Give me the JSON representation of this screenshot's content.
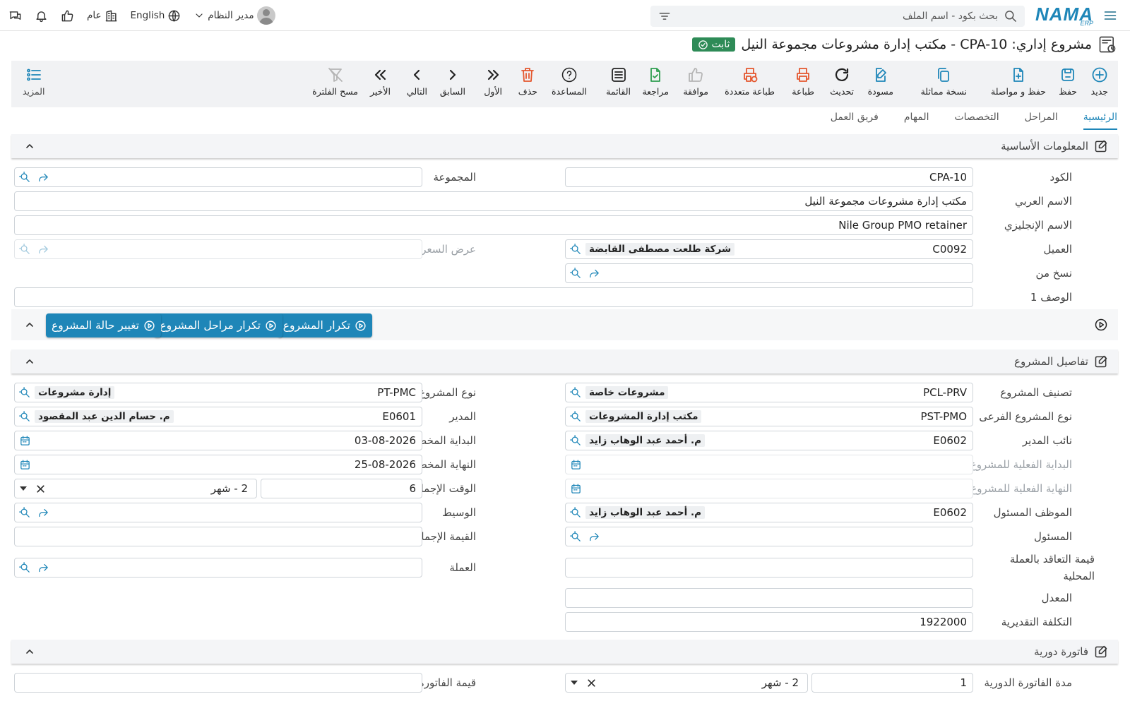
{
  "topbar": {
    "logo_text": "NAMA",
    "logo_sub": "ERP",
    "search_placeholder": "بحث بكود - اسم الملف",
    "company": "عام",
    "language": "English",
    "user": "مدير النظام"
  },
  "title": {
    "text": "مشروع إداري: CPA-10 - مكتب إدارة مشروعات مجموعة النيل",
    "status": "ثابت"
  },
  "toolbar": {
    "new": "جديد",
    "save": "حفظ",
    "save_continue": "حفظ و مواصلة",
    "duplicate": "نسخة مماثلة",
    "draft": "مسودة",
    "refresh": "تحديث",
    "print": "طباعة",
    "multi_print": "طباعة متعددة",
    "approve": "موافقة",
    "review": "مراجعة",
    "list": "القائمة",
    "help": "المساعدة",
    "delete": "حذف",
    "first": "الأول",
    "previous": "السابق",
    "next": "التالي",
    "last": "الأخير",
    "clear_filter": "مسح الفلترة",
    "more": "المزيد"
  },
  "tabs": [
    "الرئيسية",
    "المراحل",
    "التخصصات",
    "المهام",
    "فريق العمل"
  ],
  "basic": {
    "title": "المعلومات الأساسية",
    "code_label": "الكود",
    "code": "CPA-10",
    "group_label": "المجموعة",
    "arabic_name_label": "الاسم العربي",
    "arabic_name": "مكتب إدارة مشروعات مجموعة النيل",
    "english_name_label": "الاسم الإنجليزي",
    "english_name": "Nile Group PMO retainer",
    "customer_label": "العميل",
    "customer_code": "C0092",
    "customer_name": "شركة طلعت مصطفى القابضة",
    "quotation_label": "عرض السعر",
    "copied_from_label": "نسخ من",
    "description_label": "الوصف 1"
  },
  "actions": {
    "repeat_project": "تكرار المشروع",
    "repeat_stages": "تكرار مراحل المشروع",
    "change_status": "تغيير حالة المشروع"
  },
  "details": {
    "title": "تفاصيل المشروع",
    "category_label": "تصنيف المشروع",
    "category_code": "PCL-PRV",
    "category_name": "مشروعات خاصة",
    "type_label": "نوع المشروع",
    "type_code": "PT-PMC",
    "type_name": "إدارة مشروعات",
    "subtype_label": "نوع المشروع الفرعى",
    "subtype_code": "PST-PMO",
    "subtype_name": "مكتب إدارة المشروعات",
    "manager_label": "المدير",
    "manager_code": "E0601",
    "manager_name": "م. حسام الدين عبد المقصود",
    "deputy_label": "نائب المدير",
    "deputy_code": "E0602",
    "deputy_name": "م. أحمد عبد الوهاب زايد",
    "planned_start_label": "البداية المخططة للمشروع",
    "planned_start": "03-08-2026",
    "actual_start_label": "البداية الفعلية للمشروع",
    "planned_end_label": "النهاية المخططة للمشروع",
    "planned_end": "25-08-2026",
    "actual_end_label": "النهاية الفعلية للمشروع",
    "total_time_label": "الوقت الإجمالي للمشروع",
    "total_time": "6",
    "total_time_unit": "2 - شهر",
    "responsible_emp_label": "الموظف المسئول",
    "responsible_emp_code": "E0602",
    "responsible_emp_name": "م. أحمد عبد الوهاب زايد",
    "broker_label": "الوسيط",
    "responsible_label": "المسئول",
    "contract_total_label": "القيمة الإجمالية للتعاقد",
    "contract_local_label": "قيمة التعاقد بالعملة المحلية",
    "currency_label": "العملة",
    "rate_label": "المعدل",
    "estimated_cost_label": "التكلفة التقديرية",
    "estimated_cost": "1922000"
  },
  "invoice": {
    "title": "فاتورة دورية",
    "period_label": "مدة الفاتورة الدورية",
    "period": "1",
    "period_unit": "2 - شهر",
    "value_label": "قيمة الفاتورة الدورية"
  }
}
